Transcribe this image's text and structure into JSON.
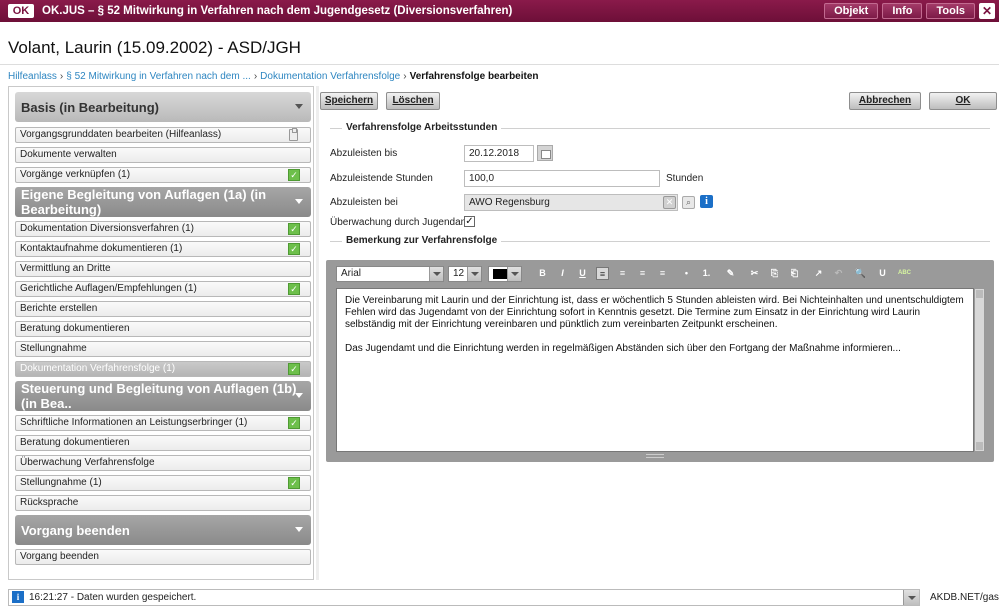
{
  "window": {
    "logo": "OK",
    "title": "OK.JUS – § 52 Mitwirkung in Verfahren nach dem Jugendgesetz (Diversionsverfahren)",
    "buttons": [
      "Objekt",
      "Info",
      "Tools"
    ],
    "close": "✕"
  },
  "person": {
    "title": "Volant, Laurin (15.09.2002) - ASD/JGH"
  },
  "breadcrumb": {
    "items": [
      "Hilfeanlass",
      "§ 52 Mitwirkung in Verfahren nach dem ...",
      "Dokumentation Verfahrensfolge"
    ],
    "current": "Verfahrensfolge bearbeiten",
    "separator": "›"
  },
  "sidebar": {
    "sections": [
      {
        "title": "Basis (in Bearbeitung)",
        "items": [
          {
            "label": "Vorgangsgrunddaten bearbeiten (Hilfeanlass)",
            "icon": "clipboard-icon"
          },
          {
            "label": "Dokumente verwalten"
          },
          {
            "label": "Vorgänge verknüpfen (1)",
            "icon": "check-icon"
          }
        ]
      },
      {
        "title": "Eigene Begleitung von Auflagen (1a) (in Bearbeitung)",
        "items": [
          {
            "label": "Dokumentation Diversionsverfahren (1)",
            "icon": "check-icon"
          },
          {
            "label": "Kontaktaufnahme dokumentieren (1)",
            "icon": "check-icon"
          },
          {
            "label": "Vermittlung an Dritte"
          },
          {
            "label": "Gerichtliche  Auflagen/Empfehlungen (1)",
            "icon": "check-icon"
          },
          {
            "label": "Berichte erstellen"
          },
          {
            "label": "Beratung dokumentieren"
          },
          {
            "label": "Stellungnahme"
          },
          {
            "label": "Dokumentation Verfahrensfolge (1)",
            "icon": "check-icon",
            "selected": true
          }
        ]
      },
      {
        "title": "Steuerung und Begleitung von Auflagen (1b) (in Bea..",
        "items": [
          {
            "label": "Schriftliche Informationen an Leistungserbringer (1)",
            "icon": "check-icon"
          },
          {
            "label": "Beratung dokumentieren"
          },
          {
            "label": "Überwachung Verfahrensfolge"
          },
          {
            "label": "Stellungnahme (1)",
            "icon": "check-icon"
          },
          {
            "label": "Rücksprache"
          }
        ]
      },
      {
        "title": "Vorgang beenden",
        "items": [
          {
            "label": "Vorgang beenden"
          }
        ]
      }
    ]
  },
  "actions": {
    "save": "Speichern",
    "delete": "Löschen",
    "cancel": "Abbrechen",
    "ok": "OK"
  },
  "form": {
    "section1": "Verfahrensfolge Arbeitsstunden",
    "due_label": "Abzuleisten bis",
    "due_value": "20.12.2018",
    "hours_label": "Abzuleistende Stunden",
    "hours_value": "100,0",
    "hours_unit": "Stunden",
    "provider_label": "Abzuleisten bei",
    "provider_value": "AWO Regensburg",
    "monitor_label": "Überwachung durch Jugendamt",
    "monitor_checked": "✓",
    "section2": "Bemerkung zur Verfahrensfolge"
  },
  "editor": {
    "font": "Arial",
    "size": "12",
    "tools": [
      "B",
      "I",
      "U",
      "≡",
      "≡",
      "≡",
      "≡",
      "•",
      "1.",
      "✎",
      "✂",
      "⎘",
      "⎗",
      "↗",
      "↶",
      "🔍",
      "U",
      "ABC"
    ],
    "paragraphs": [
      "Die Vereinbarung mit Laurin und der Einrichtung ist, dass er wöchentlich 5 Stunden ableisten wird. Bei Nichteinhalten und unentschuldigtem Fehlen wird das Jugendamt von der Einrichtung sofort in Kenntnis gesetzt. Die Termine zum Einsatz in der Einrichtung wird Laurin selbständig mit der Einrichtung vereinbaren und pünktlich zum vereinbarten Zeitpunkt erscheinen.",
      "Das Jugendamt und die Einrichtung werden in regelmäßigen Abständen sich über den Fortgang der Maßnahme informieren..."
    ]
  },
  "status": {
    "message": "16:21:27 - Daten wurden gespeichert.",
    "user": "AKDB.NET/gast"
  }
}
